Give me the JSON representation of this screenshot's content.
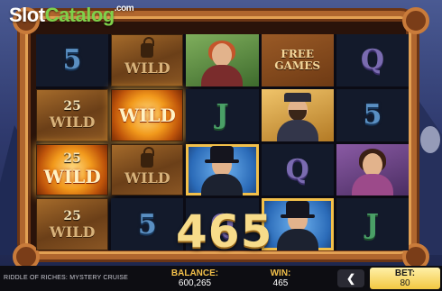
{
  "logo": {
    "part1": "Slot",
    "part2": "Catalog",
    "suffix": ".com"
  },
  "reels": [
    [
      {
        "type": "letter",
        "value": "5"
      },
      {
        "type": "wild",
        "label": "WILD",
        "state": "plain"
      },
      {
        "type": "portrait",
        "character": "redhead-woman"
      },
      {
        "type": "free-games",
        "line1": "FREE",
        "line2": "GAMES"
      },
      {
        "type": "letter",
        "value": "Q"
      }
    ],
    [
      {
        "type": "wild",
        "label": "WILD",
        "number": "25",
        "state": "plain"
      },
      {
        "type": "wild",
        "label": "WILD",
        "state": "lit"
      },
      {
        "type": "letter",
        "value": "J"
      },
      {
        "type": "portrait",
        "character": "bearded-sailor"
      },
      {
        "type": "letter",
        "value": "5"
      }
    ],
    [
      {
        "type": "wild",
        "label": "WILD",
        "number": "25",
        "state": "lit"
      },
      {
        "type": "wild",
        "label": "WILD",
        "state": "plain"
      },
      {
        "type": "portrait",
        "character": "detective-top-hat",
        "highlight": true
      },
      {
        "type": "letter",
        "value": "Q"
      },
      {
        "type": "portrait",
        "character": "lady-purple"
      }
    ],
    [
      {
        "type": "wild",
        "label": "WILD",
        "number": "25",
        "state": "plain"
      },
      {
        "type": "letter",
        "value": "5"
      },
      {
        "type": "letter",
        "value": "Q"
      },
      {
        "type": "portrait",
        "character": "detective-top-hat",
        "highlight": true
      },
      {
        "type": "letter",
        "value": "J"
      }
    ]
  ],
  "win_display": "465",
  "status_bar": {
    "game_title": "RIDDLE OF RICHES: MYSTERY CRUISE",
    "balance_label": "BALANCE:",
    "balance_value": "600,265",
    "win_label": "WIN:",
    "win_value": "465",
    "back_icon": "chevron-left-icon",
    "bet_label": "BET:",
    "bet_value": "80"
  },
  "colors": {
    "accent_gold": "#f3c04a",
    "frame_copper": "#b0662e",
    "bar_bg": "#0d0d12"
  }
}
